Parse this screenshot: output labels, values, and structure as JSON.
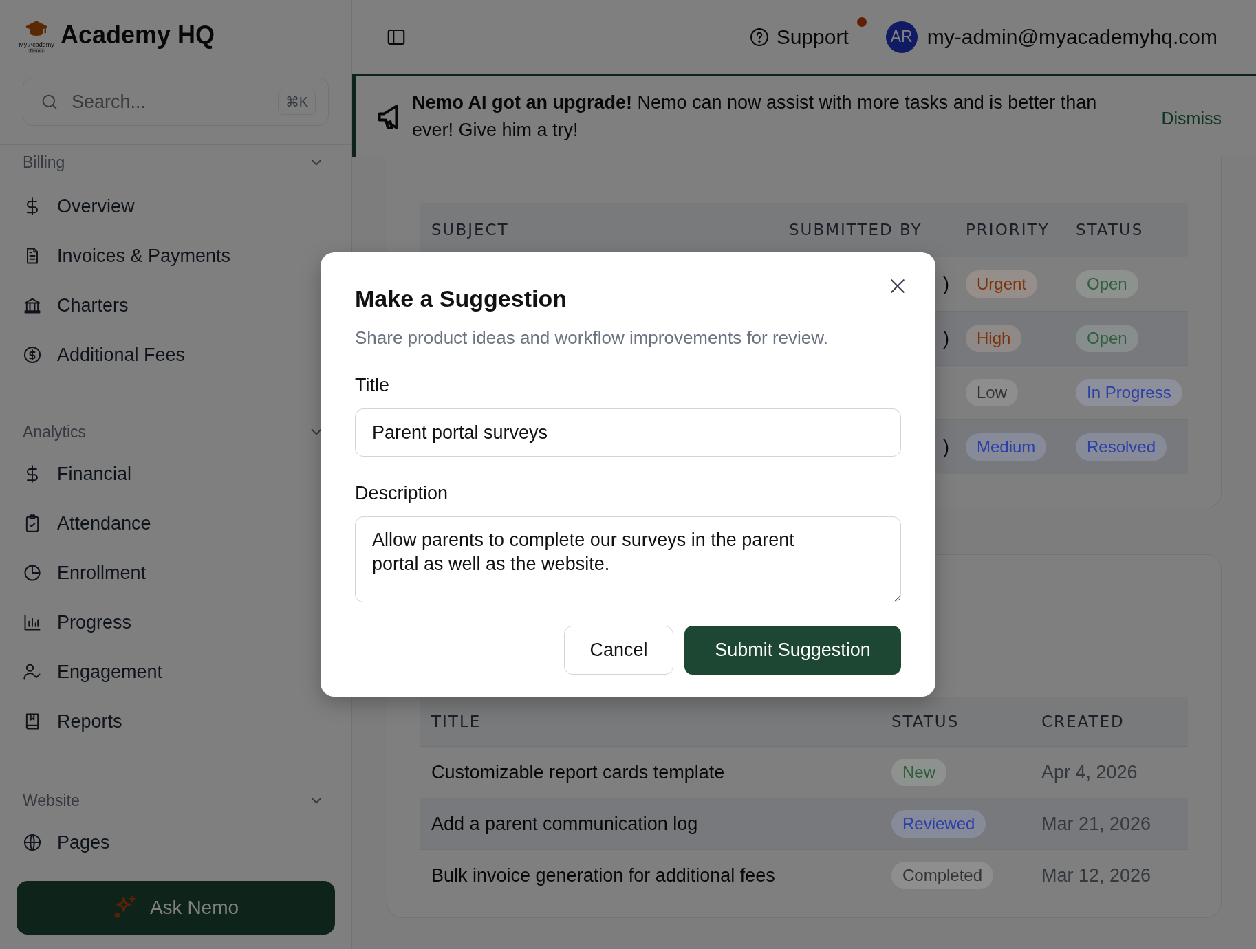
{
  "sidebar": {
    "brand": {
      "logo_text": "My Academy",
      "logo_badge": "Demo",
      "name": "Academy HQ"
    },
    "search": {
      "placeholder": "Search...",
      "shortcut": "⌘K"
    },
    "sections": [
      {
        "title": "Billing",
        "expanded": true,
        "items": [
          {
            "label": "Overview"
          },
          {
            "label": "Invoices & Payments"
          },
          {
            "label": "Charters"
          },
          {
            "label": "Additional Fees"
          }
        ]
      },
      {
        "title": "Analytics",
        "expanded": true,
        "items": [
          {
            "label": "Financial"
          },
          {
            "label": "Attendance"
          },
          {
            "label": "Enrollment"
          },
          {
            "label": "Progress"
          },
          {
            "label": "Engagement"
          },
          {
            "label": "Reports"
          }
        ]
      },
      {
        "title": "Website",
        "expanded": true,
        "items": [
          {
            "label": "Pages"
          }
        ]
      }
    ],
    "ask_button": "Ask Nemo"
  },
  "header": {
    "support": "Support",
    "notification": true,
    "avatar": "AR",
    "email": "my-admin@myacademyhq.com"
  },
  "banner": {
    "message": "**Nemo AI got an upgrade!**  Nemo can now assist with more tasks and is better than ever! Give him a try!",
    "dismiss": "Dismiss"
  },
  "requests_table": {
    "columns": [
      "SUBJECT",
      "SUBMITTED BY",
      "PRIORITY",
      "STATUS"
    ],
    "rows": [
      {
        "submitted_by": ")",
        "priority": {
          "label": "Urgent",
          "color": "#7a330a"
        },
        "status": {
          "label": "Open",
          "color": "#2f5e3e"
        }
      },
      {
        "submitted_by": ")",
        "priority": {
          "label": "High",
          "color": "#7a330a"
        },
        "status": {
          "label": "Open",
          "color": "#2f5e3e"
        }
      },
      {
        "priority": {
          "label": "Low",
          "color": "#333333"
        },
        "status": {
          "label": "In Progress",
          "color": "#2b3fa8"
        }
      },
      {
        "submitted_by": ")",
        "priority": {
          "label": "Medium",
          "color": "#2b3fa8"
        },
        "status": {
          "label": "Resolved",
          "color": "#2b3fa8"
        }
      }
    ]
  },
  "suggestions_table": {
    "columns": [
      "TITLE",
      "STATUS",
      "CREATED"
    ],
    "rows": [
      {
        "title": "Customizable report cards template",
        "status": {
          "label": "New",
          "color": "#2f5e3e"
        },
        "created": "Apr 4, 2026"
      },
      {
        "title": "Add a parent communication log",
        "status": {
          "label": "Reviewed",
          "color": "#2b3fa8"
        },
        "created": "Mar 21, 2026"
      },
      {
        "title": "Bulk invoice generation for additional fees",
        "status": {
          "label": "Completed",
          "color": "#333333"
        },
        "created": "Mar 12, 2026"
      }
    ]
  },
  "modal": {
    "title": "Make a Suggestion",
    "subtitle": "Share product ideas and workflow improvements for review.",
    "fields": [
      {
        "label": "Title",
        "kind": "input",
        "value": "Parent portal surveys"
      },
      {
        "label": "Description",
        "kind": "textarea",
        "value": "Allow parents to complete our surveys in the parent portal as well as the website."
      }
    ],
    "buttons": [
      {
        "label": "Cancel",
        "kind": "secondary"
      },
      {
        "label": "Submit Suggestion",
        "kind": "primary"
      }
    ]
  }
}
